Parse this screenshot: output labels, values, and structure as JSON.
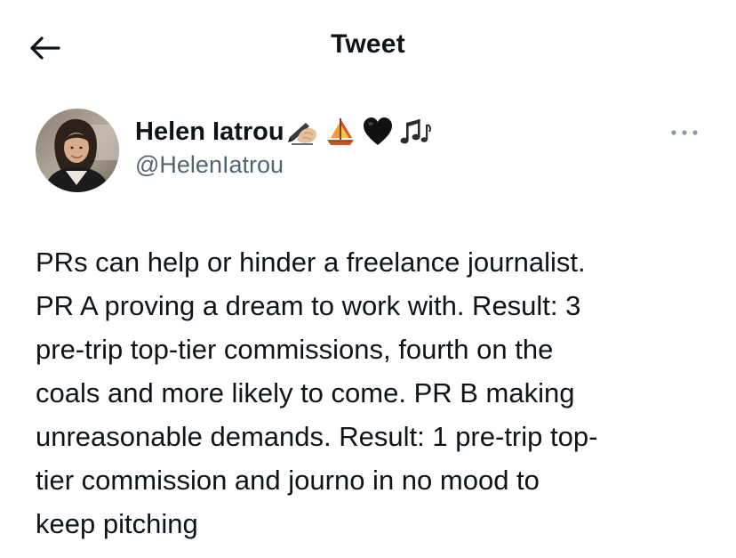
{
  "header": {
    "title": "Tweet",
    "back_icon": "arrow-left-icon"
  },
  "author": {
    "name": "Helen Iatrou",
    "handle": "@HelenIatrou",
    "emojis": [
      "writing-hand-emoji",
      "sailboat-emoji",
      "black-heart-emoji",
      "musical-notes-emoji"
    ],
    "more_icon": "more-horizontal-icon"
  },
  "tweet": {
    "lines": [
      "PRs can help or hinder a freelance journalist.",
      "PR A proving a dream to work with. Result: 3",
      "pre-trip top-tier commissions, fourth on the",
      "coals and more likely to come. PR B making",
      "unreasonable demands. Result: 1 pre-trip top-",
      "tier commission and journo in no mood to",
      "keep pitching"
    ]
  },
  "colors": {
    "text": "#0f1419",
    "secondary": "#536471",
    "background": "#ffffff"
  }
}
